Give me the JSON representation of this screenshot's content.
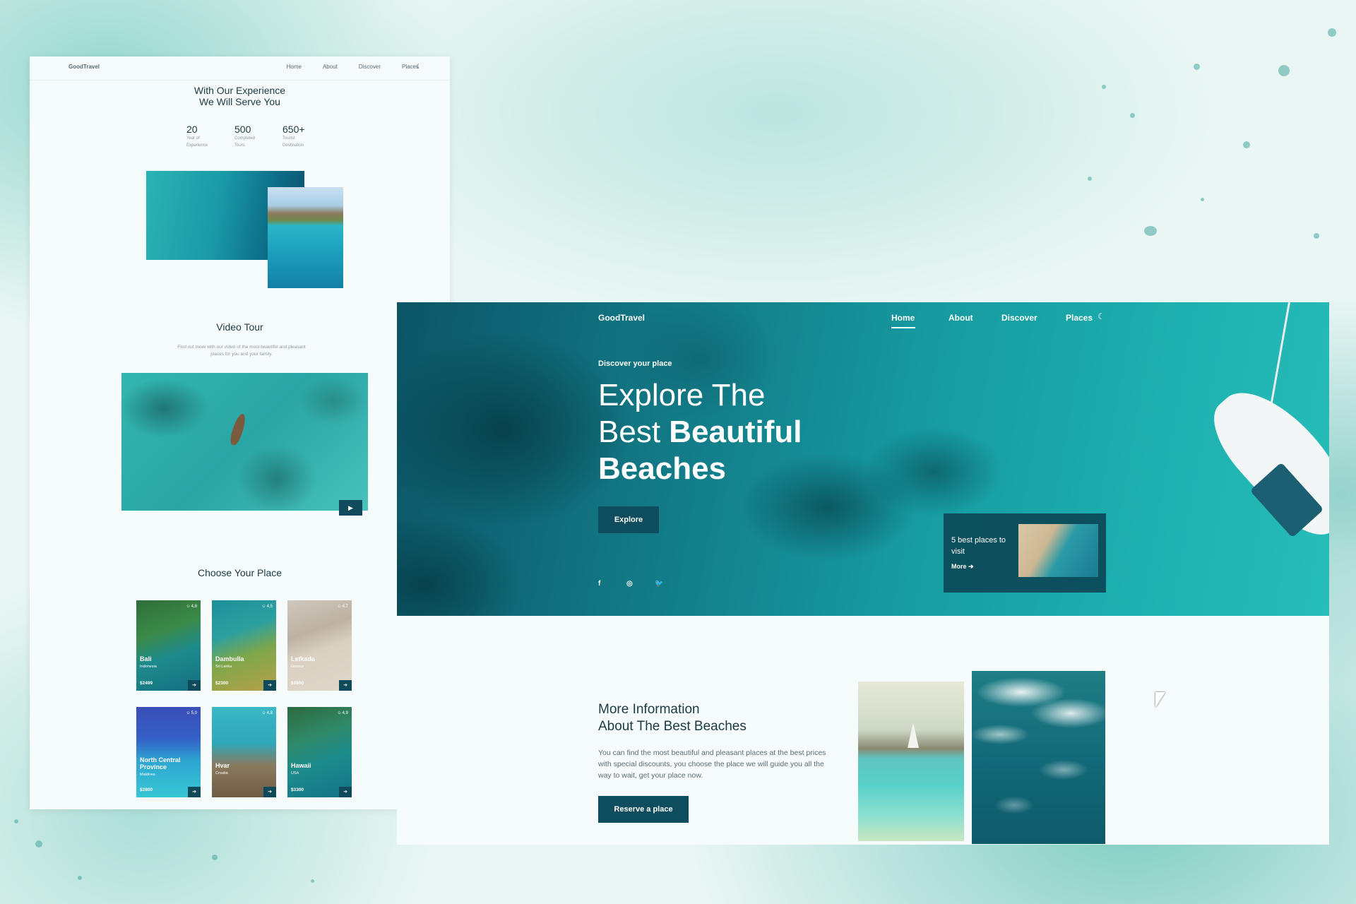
{
  "left_page": {
    "nav": {
      "logo": "GoodTravel",
      "items": [
        "Home",
        "About",
        "Discover",
        "Places"
      ],
      "theme_icon": "moon-icon"
    },
    "experience": {
      "heading_line1": "With Our Experience",
      "heading_line2": "We Will Serve You",
      "stats": [
        {
          "value": "20",
          "label": "Year of Experience"
        },
        {
          "value": "500",
          "label": "Completed Tours"
        },
        {
          "value": "650+",
          "label": "Tourist Destination"
        }
      ]
    },
    "video": {
      "title": "Video Tour",
      "description": "Find out more with our video of the most beautiful and pleasant places for you and your family.",
      "play_icon": "▶"
    },
    "places": {
      "title": "Choose Your Place",
      "cards": [
        {
          "name": "Bali",
          "country": "Indonesia",
          "price": "$2499",
          "rating": "✩ 4,8"
        },
        {
          "name": "Dambulla",
          "country": "Sri Lanka",
          "price": "$2300",
          "rating": "✩ 4,5"
        },
        {
          "name": "Lefkada",
          "country": "Greece",
          "price": "$2800",
          "rating": "✩ 4,7"
        },
        {
          "name": "North Central Province",
          "country": "Maldives",
          "price": "$2800",
          "rating": "✩ 5,0"
        },
        {
          "name": "Hvar",
          "country": "Croatia",
          "price": "",
          "rating": "✩ 4,8"
        },
        {
          "name": "Hawaii",
          "country": "USA",
          "price": "$3300",
          "rating": "✩ 4,9"
        }
      ]
    }
  },
  "main_page": {
    "nav": {
      "logo": "GoodTravel",
      "items": [
        "Home",
        "About",
        "Discover",
        "Places"
      ],
      "active": "Home"
    },
    "hero": {
      "subtitle": "Discover your place",
      "title_line1": "Explore The",
      "title_line2_light": "Best ",
      "title_line2_bold": "Beautiful",
      "title_line3": "Beaches",
      "button": "Explore",
      "social": [
        "f",
        "◎",
        "🐦"
      ],
      "card": {
        "title": "5 best places to visit",
        "more": "More ➔"
      }
    },
    "info": {
      "title_line1": "More Information",
      "title_line2": "About The Best Beaches",
      "description": "You can find the most beautiful and pleasant places at the best prices with special discounts, you choose the place we will guide you all the way to wait, get your place now.",
      "button": "Reserve a place"
    }
  },
  "colors": {
    "accent": "#0e4d5e",
    "text_dark": "#1b3a44",
    "background": "#eaf6f4"
  }
}
